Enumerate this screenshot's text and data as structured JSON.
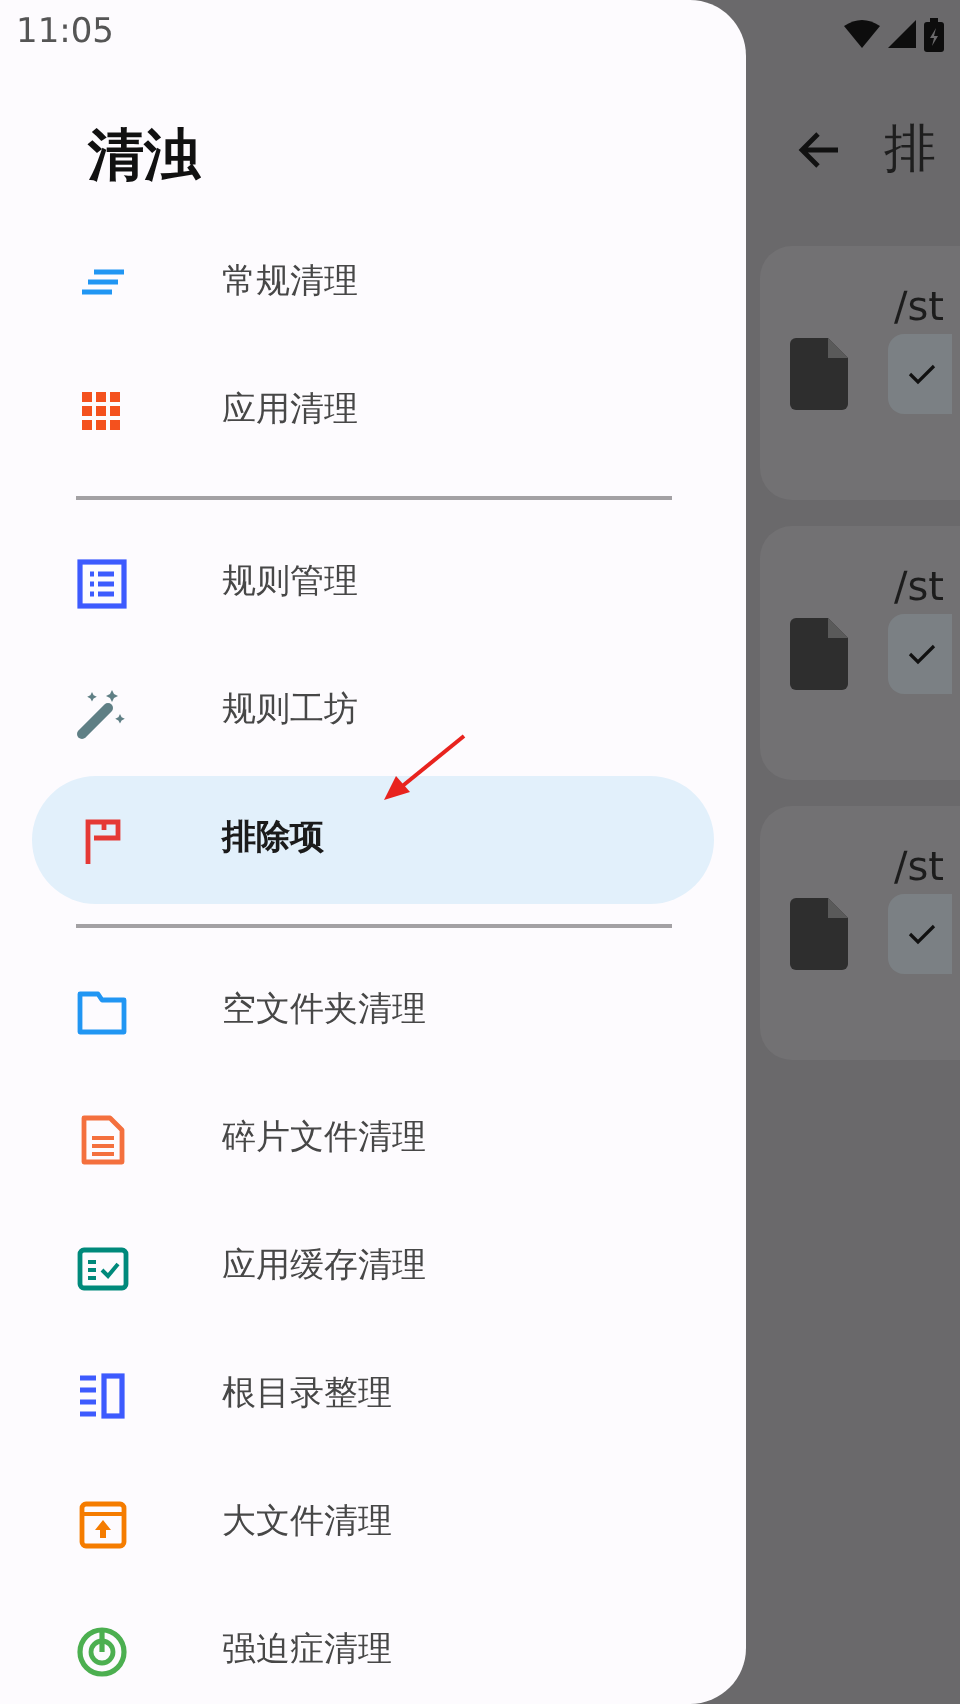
{
  "status_bar": {
    "time": "11:05"
  },
  "drawer": {
    "title": "清浊",
    "sections": [
      {
        "items": [
          {
            "label": "常规清理",
            "color": "#2196f3",
            "selected": false
          },
          {
            "label": "应用清理",
            "color": "#f4511e",
            "selected": false
          }
        ]
      },
      {
        "items": [
          {
            "label": "规则管理",
            "color": "#3d5afe",
            "selected": false
          },
          {
            "label": "规则工坊",
            "color": "#5f7f85",
            "selected": false
          },
          {
            "label": "排除项",
            "color": "#e53935",
            "selected": true
          }
        ]
      },
      {
        "items": [
          {
            "label": "空文件夹清理",
            "color": "#2196f3",
            "selected": false
          },
          {
            "label": "碎片文件清理",
            "color": "#f4703e",
            "selected": false
          },
          {
            "label": "应用缓存清理",
            "color": "#00897b",
            "selected": false
          },
          {
            "label": "根目录整理",
            "color": "#3d5afe",
            "selected": false
          },
          {
            "label": "大文件清理",
            "color": "#f57c00",
            "selected": false
          },
          {
            "label": "强迫症清理",
            "color": "#4caf50",
            "selected": false
          }
        ]
      }
    ]
  },
  "background_screen": {
    "title": "排",
    "cards": [
      {
        "path": "/st"
      },
      {
        "path": "/st"
      },
      {
        "path": "/st"
      }
    ]
  }
}
